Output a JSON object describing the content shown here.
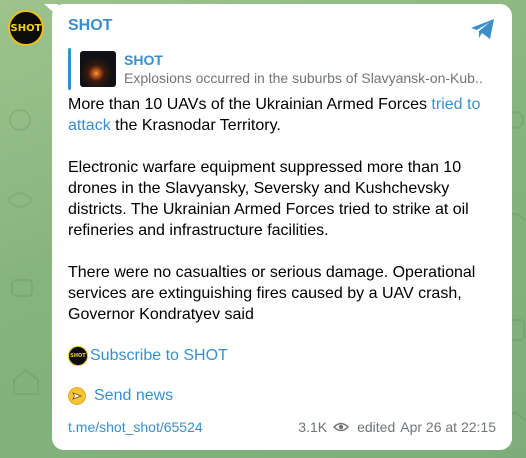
{
  "channel": {
    "avatar_text": "SHOT",
    "name": "SHOT",
    "share_icon": "telegram-share-icon"
  },
  "reply": {
    "title": "SHOT",
    "snippet": "Explosions occurred in the suburbs of Slavyansk-on-Kub..."
  },
  "message": {
    "p1_before": "More than 10 UAVs of the Ukrainian Armed Forces ",
    "p1_link": "tried to attack",
    "p1_after": " the Krasnodar Territory.",
    "p2": "Electronic warfare equipment suppressed more than 10 drones in the Slavyansky, Seversky and Kushchevsky districts. The Ukrainian Armed Forces tried to strike at oil refineries and infrastructure facilities.",
    "p3": "There were no casualties or serious damage. Operational services are extinguishing fires caused by a UAV crash, Governor Kondratyev said"
  },
  "links": {
    "subscribe_logo_text": "SHOT",
    "subscribe": "Subscribe to SHOT",
    "send_news_icon": "emoji-send-icon",
    "send_news": "Send news"
  },
  "footer": {
    "post_link": "t.me/shot_shot/65524",
    "views": "3.1K",
    "views_icon": "eye-icon",
    "edited": "edited",
    "date": "Apr 26 at 22:15"
  },
  "colors": {
    "accent": "#3a8fcb",
    "meta_text": "#707579",
    "background": "#86b47d",
    "avatar_ring": "#e8c21a"
  }
}
